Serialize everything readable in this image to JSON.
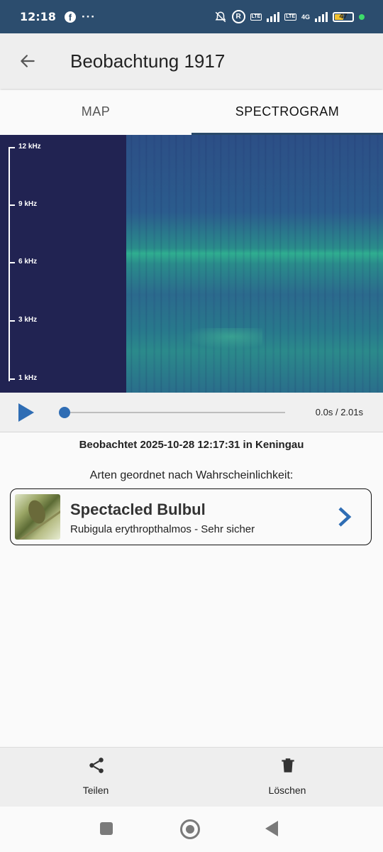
{
  "status_bar": {
    "time": "12:18",
    "battery": "47",
    "network_4g": "4G",
    "lte": "LTE",
    "r_icon": "R"
  },
  "app_bar": {
    "title": "Beobachtung 1917",
    "back_icon": "arrow-left-icon"
  },
  "tabs": [
    {
      "label": "MAP",
      "active": false
    },
    {
      "label": "SPECTROGRAM",
      "active": true
    }
  ],
  "spectrogram": {
    "freq_labels": [
      "12 kHz",
      "9 kHz",
      "6 kHz",
      "3 kHz",
      "1 kHz"
    ]
  },
  "player": {
    "timecode": "0.0s / 2.01s",
    "progress": 0.0
  },
  "observation": {
    "observed_text": "Beobachtet 2025-10-28 12:17:31 in Keningau",
    "sorted_label": "Arten geordnet nach Wahrscheinlichkeit:"
  },
  "species": [
    {
      "common_name": "Spectacled Bulbul",
      "detail": "Rubigula erythropthalmos - Sehr sicher"
    }
  ],
  "bottom_actions": {
    "share": "Teilen",
    "delete": "Löschen"
  },
  "colors": {
    "accent": "#2f6db4",
    "status_bar": "#2c4d6e",
    "tab_indicator": "#2a4a6a"
  }
}
